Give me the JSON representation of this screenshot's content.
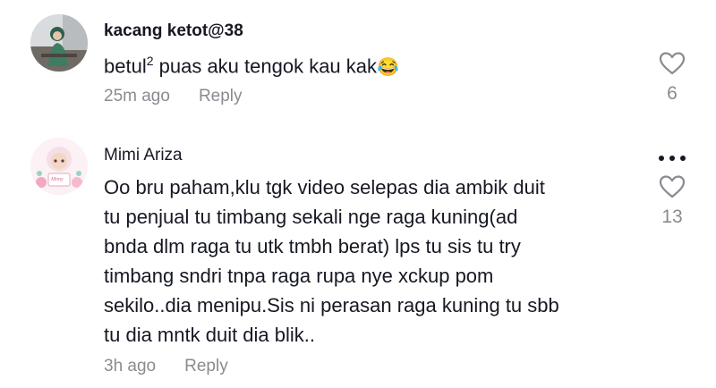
{
  "comments": [
    {
      "author": "kacang ketot@38",
      "text_main": "betul",
      "text_sup": "2",
      "text_rest": " puas aku tengok kau kak",
      "emoji": "😂",
      "time": "25m ago",
      "reply_label": "Reply",
      "likes": "6",
      "like_icon": "heart-outline-icon"
    },
    {
      "author": "Mimi Ariza",
      "text": "Oo bru paham,klu tgk video selepas dia ambik duit\ntu penjual tu timbang sekali nge raga kuning(ad\nbnda dlm raga tu utk tmbh berat) lps tu sis tu try\ntimbang sndri tnpa raga rupa nye xckup pom\nsekilo..dia menipu.Sis ni perasan raga kuning tu sbb\ntu dia mntk duit dia blik..",
      "time": "3h ago",
      "reply_label": "Reply",
      "likes": "13",
      "like_icon": "heart-outline-icon",
      "menu_icon": "more-dots-icon",
      "avatar_badge": "Mimy"
    }
  ],
  "colors": {
    "text": "#161823",
    "secondary": "#8a8b91",
    "background": "#ffffff"
  }
}
